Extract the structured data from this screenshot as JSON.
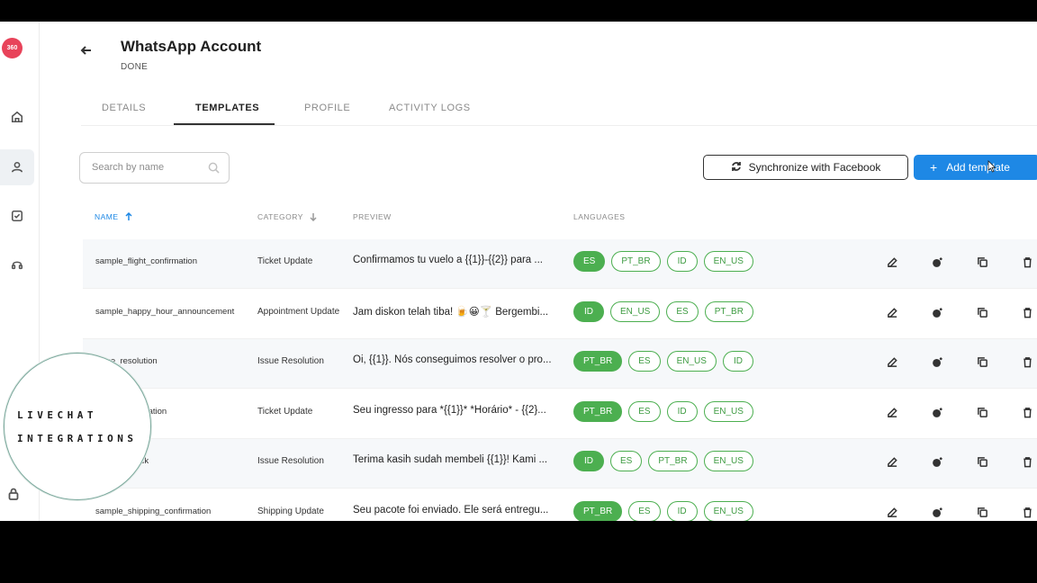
{
  "header": {
    "title": "WhatsApp Account",
    "subtitle": "DONE",
    "logo_text": "360"
  },
  "tabs": [
    {
      "label": "DETAILS"
    },
    {
      "label": "TEMPLATES",
      "active": true
    },
    {
      "label": "PROFILE"
    },
    {
      "label": "ACTIVITY LOGS"
    }
  ],
  "search": {
    "placeholder": "Search by name",
    "value": ""
  },
  "toolbar": {
    "sync_label": "Synchronize with Facebook",
    "add_label": "Add template",
    "add_plus": "+"
  },
  "table": {
    "columns": {
      "name": "NAME",
      "category": "CATEGORY",
      "preview": "PREVIEW",
      "languages": "LANGUAGES"
    },
    "sort": {
      "column": "NAME",
      "direction": "ascending"
    },
    "rows": [
      {
        "name": "sample_flight_confirmation",
        "category": "Ticket Update",
        "preview": "Confirmamos tu vuelo a {{1}}-{{2}} para ...",
        "languages": [
          "ES",
          "PT_BR",
          "ID",
          "EN_US"
        ]
      },
      {
        "name": "sample_happy_hour_announcement",
        "category": "Appointment Update",
        "preview": "Jam diskon telah tiba! 🍺😀🍸 Bergembi...",
        "languages": [
          "ID",
          "EN_US",
          "ES",
          "PT_BR"
        ]
      },
      {
        "name": "issue_resolution",
        "category": "Issue Resolution",
        "preview": "Oi, {{1}}. Nós conseguimos resolver o pro...",
        "languages": [
          "PT_BR",
          "ES",
          "EN_US",
          "ID"
        ]
      },
      {
        "name": "ticket_confirmation",
        "category": "Ticket Update",
        "preview": "Seu ingresso para *{{1}}* *Horário* - {{2}...",
        "languages": [
          "PT_BR",
          "ES",
          "ID",
          "EN_US"
        ]
      },
      {
        "name": "ase_feedback",
        "category": "Issue Resolution",
        "preview": "Terima kasih sudah membeli {{1}}! Kami ...",
        "languages": [
          "ID",
          "ES",
          "PT_BR",
          "EN_US"
        ]
      },
      {
        "name": "sample_shipping_confirmation",
        "category": "Shipping Update",
        "preview": "Seu pacote foi enviado. Ele será entregu...",
        "languages": [
          "PT_BR",
          "ES",
          "ID",
          "EN_US"
        ]
      }
    ]
  },
  "watermark": {
    "line1": "LIVECHAT",
    "line2": "INTEGRATIONS"
  },
  "colors": {
    "accent_blue": "#1e88e5",
    "language_green": "#4caf50",
    "logo_red": "#e8435a"
  },
  "icons": {
    "rail": [
      "home-icon",
      "user-icon",
      "inbox-icon",
      "headset-icon",
      "lock-icon"
    ],
    "row_actions": [
      "edit-icon",
      "test-message-icon",
      "copy-icon",
      "trash-icon"
    ]
  }
}
